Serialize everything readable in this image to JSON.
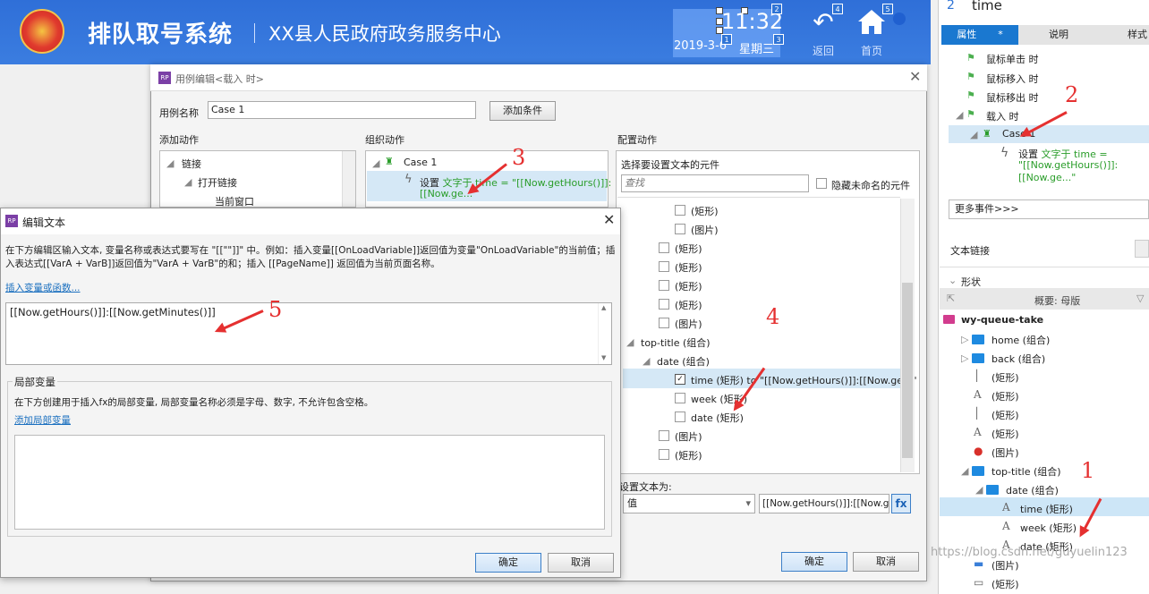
{
  "header": {
    "title": "排队取号系统",
    "subtitle": "XX县人民政府政务服务中心",
    "time": "11:32",
    "date": "2019-3-6",
    "weekday": "星期三",
    "back_label": "返回",
    "home_label": "首页",
    "badges": [
      "1",
      "2",
      "3",
      "4",
      "5"
    ]
  },
  "right_panel": {
    "widget_index": "2",
    "widget_name": "time",
    "tabs": [
      "属性",
      "说明",
      "样式"
    ],
    "tab_star": "*",
    "events": [
      "鼠标单击 时",
      "鼠标移入 时",
      "鼠标移出 时",
      "载入 时"
    ],
    "case_label": "Case 1",
    "action_prefix": "设置",
    "action_green": "文字于 time =",
    "action_line2": "\"[[Now.getHours()]]:",
    "action_line3": "[[Now.ge...\"",
    "more_events": "更多事件>>>",
    "text_link": "文本链接",
    "shape_section": "形状",
    "outline_title": "概要: 母版",
    "outline": [
      {
        "label": "wy-queue-take",
        "indent": 0,
        "icon": "master-icon"
      },
      {
        "label": "home (组合)",
        "indent": 1,
        "icon": "folder-icon"
      },
      {
        "label": "back (组合)",
        "indent": 1,
        "icon": "folder-icon"
      },
      {
        "label": "(矩形)",
        "indent": 1,
        "icon": "line-icon"
      },
      {
        "label": "(矩形)",
        "indent": 1,
        "icon": "text-icon"
      },
      {
        "label": "(矩形)",
        "indent": 1,
        "icon": "line-icon"
      },
      {
        "label": "(矩形)",
        "indent": 1,
        "icon": "text-icon"
      },
      {
        "label": "(图片)",
        "indent": 1,
        "icon": "emblem-icon"
      },
      {
        "label": "top-title (组合)",
        "indent": 1,
        "icon": "folder-icon"
      },
      {
        "label": "date (组合)",
        "indent": 2,
        "icon": "folder-icon"
      },
      {
        "label": "time (矩形)",
        "indent": 3,
        "icon": "text-icon"
      },
      {
        "label": "week (矩形)",
        "indent": 3,
        "icon": "text-icon"
      },
      {
        "label": "date (矩形)",
        "indent": 3,
        "icon": "text-icon"
      },
      {
        "label": "(图片)",
        "indent": 1,
        "icon": "image-icon"
      },
      {
        "label": "(矩形)",
        "indent": 1,
        "icon": "rect-icon"
      }
    ],
    "watermark": "https://blog.csdn.net/guyuelin123"
  },
  "case_dialog": {
    "title": "用例编辑<载入 时>",
    "case_name_label": "用例名称",
    "case_name_value": "Case 1",
    "add_condition": "添加条件",
    "col_add_action": "添加动作",
    "col_organize": "组织动作",
    "col_configure": "配置动作",
    "add_tree": [
      "链接",
      "打开链接",
      "当前窗口"
    ],
    "org_case": "Case 1",
    "org_action_prefix": "设置",
    "org_action_green": "文字于 time = \"[[Now.getHours()]]:",
    "org_action_line2": "[[Now.ge...\"",
    "cfg_select_label": "选择要设置文本的元件",
    "search_placeholder": "查找",
    "hide_unnamed": "隐藏未命名的元件",
    "cfg_rows": [
      {
        "label": "(矩形)",
        "indent": 2,
        "checked": false
      },
      {
        "label": "(图片)",
        "indent": 2,
        "checked": false
      },
      {
        "label": "(矩形)",
        "indent": 1,
        "checked": false
      },
      {
        "label": "(矩形)",
        "indent": 1,
        "checked": false
      },
      {
        "label": "(矩形)",
        "indent": 1,
        "checked": false
      },
      {
        "label": "(矩形)",
        "indent": 1,
        "checked": false
      },
      {
        "label": "(图片)",
        "indent": 1,
        "checked": false
      },
      {
        "label": "top-title (组合)",
        "indent": 0,
        "group": true
      },
      {
        "label": "date (组合)",
        "indent": 1,
        "group": true
      },
      {
        "label": "time (矩形) to \"[[Now.getHours()]]:[[Now.ge...\"",
        "indent": 2,
        "checked": true
      },
      {
        "label": "week (矩形)",
        "indent": 2,
        "checked": false
      },
      {
        "label": "date (矩形)",
        "indent": 2,
        "checked": false
      },
      {
        "label": "(图片)",
        "indent": 1,
        "checked": false
      },
      {
        "label": "(矩形)",
        "indent": 1,
        "checked": false
      }
    ],
    "set_text_label": "设置文本为:",
    "set_text_type": "值",
    "set_text_value": "[[Now.getHours()]]:[[Now.getM",
    "fx": "fx",
    "ok": "确定",
    "cancel": "取消"
  },
  "edit_text_dialog": {
    "title": "编辑文本",
    "instructions": "在下方编辑区输入文本, 变量名称或表达式要写在 \"[[\"\"]]\" 中。例如：插入变量[[OnLoadVariable]]返回值为变量\"OnLoadVariable\"的当前值；插入表达式[[VarA + VarB]]返回值为\"VarA + VarB\"的和；插入 [[PageName]] 返回值为当前页面名称。",
    "insert_link": "插入变量或函数...",
    "expression": "[[Now.getHours()]]:[[Now.getMinutes()]]",
    "local_var_title": "局部变量",
    "local_var_desc": "在下方创建用于插入fx的局部变量, 局部变量名称必须是字母、数字, 不允许包含空格。",
    "add_local_var": "添加局部变量",
    "ok": "确定",
    "cancel": "取消"
  },
  "annotations": [
    "1",
    "2",
    "3",
    "4",
    "5"
  ],
  "colors": {
    "header_blue": "#3b7de0",
    "selection": "#d5e8f6",
    "annotation_red": "#e53030",
    "action_green": "#2a9d2a"
  }
}
